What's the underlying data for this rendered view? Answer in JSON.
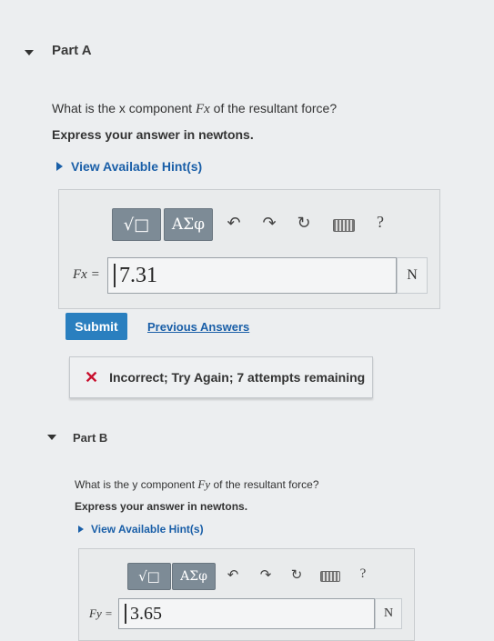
{
  "partA": {
    "title": "Part A",
    "question_pre": "What is the x component ",
    "question_var": "Fx",
    "question_post": " of the resultant force?",
    "instruction": "Express your answer in newtons.",
    "hint": "View Available Hint(s)",
    "toolbar": {
      "matrix_label": "√□",
      "greek_label": "ΑΣφ",
      "help_label": "?"
    },
    "var_label": "Fx =",
    "answer_value": "7.31",
    "unit": "N",
    "submit_label": "Submit",
    "previous_answers_label": "Previous Answers",
    "feedback": "Incorrect; Try Again; 7 attempts remaining"
  },
  "partB": {
    "title": "Part B",
    "question_pre": "What is the y component ",
    "question_var": "Fy",
    "question_post": " of the resultant force?",
    "instruction": "Express your answer in newtons.",
    "hint": "View Available Hint(s)",
    "toolbar": {
      "matrix_label": "√□",
      "greek_label": "ΑΣφ",
      "help_label": "?"
    },
    "var_label": "Fy =",
    "answer_value": "3.65",
    "unit": "N"
  },
  "colors": {
    "accent": "#1a5fa8",
    "submit": "#2a7fbf",
    "error": "#c8102e",
    "tool": "#7d8b96"
  }
}
